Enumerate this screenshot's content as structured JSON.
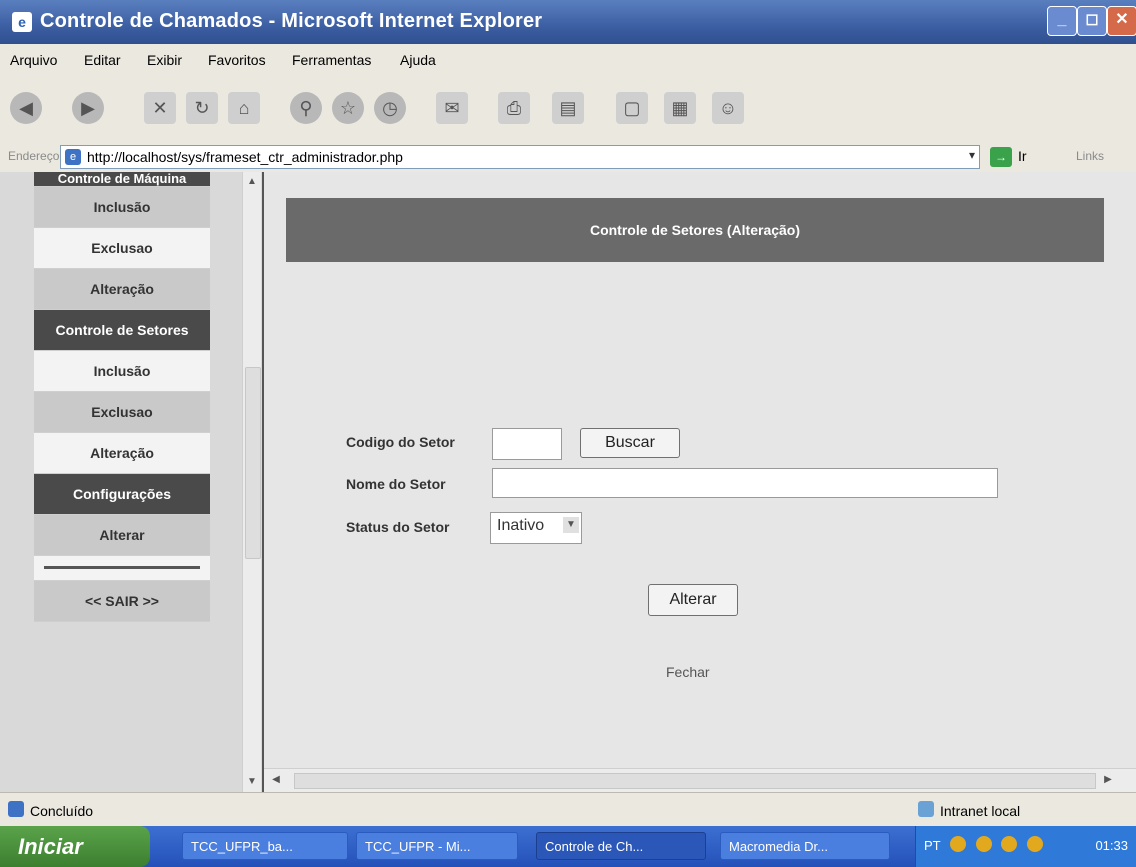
{
  "window": {
    "title": "Controle de Chamados - Microsoft Internet Explorer",
    "buttons": [
      "_",
      "◻",
      "✕"
    ]
  },
  "menubar": {
    "items": [
      "Arquivo",
      "Editar",
      "Exibir",
      "Favoritos",
      "Ferramentas",
      "Ajuda"
    ]
  },
  "addressbar": {
    "label": "Endereço",
    "url": "http://localhost/sys/frameset_ctr_administrador.php",
    "go_label": "Ir",
    "links_label": "Links"
  },
  "sidebar": {
    "items": [
      {
        "label": "Controle de Máquina",
        "type": "header-top"
      },
      {
        "label": "Inclusão",
        "type": "alt"
      },
      {
        "label": "Exclusao",
        "type": "light"
      },
      {
        "label": "Alteração",
        "type": "alt"
      },
      {
        "label": "Controle de Setores",
        "type": "header"
      },
      {
        "label": "Inclusão",
        "type": "light"
      },
      {
        "label": "Exclusao",
        "type": "alt"
      },
      {
        "label": "Alteração",
        "type": "light"
      },
      {
        "label": "Configurações",
        "type": "header"
      },
      {
        "label": "Alterar",
        "type": "alt"
      },
      {
        "label": "",
        "type": "sep"
      },
      {
        "label": "<< SAIR >>",
        "type": "alt"
      }
    ]
  },
  "main": {
    "panel_title": "Controle de Setores (Alteração)",
    "codigo_label": "Codigo do Setor",
    "codigo_value": "",
    "buscar_label": "Buscar",
    "nome_label": "Nome do Setor",
    "nome_value": "",
    "status_label": "Status do Setor",
    "status_value": "Inativo",
    "alterar_label": "Alterar",
    "fechar_label": "Fechar"
  },
  "statusbar": {
    "text": "Concluído",
    "zone": "Intranet local"
  },
  "taskbar": {
    "start_label": "Iniciar",
    "tasks": [
      "TCC_UFPR_ba...",
      "TCC_UFPR - Mi...",
      "Controle de Ch...",
      "Macromedia Dr..."
    ],
    "lang": "PT",
    "clock": "01:33"
  }
}
